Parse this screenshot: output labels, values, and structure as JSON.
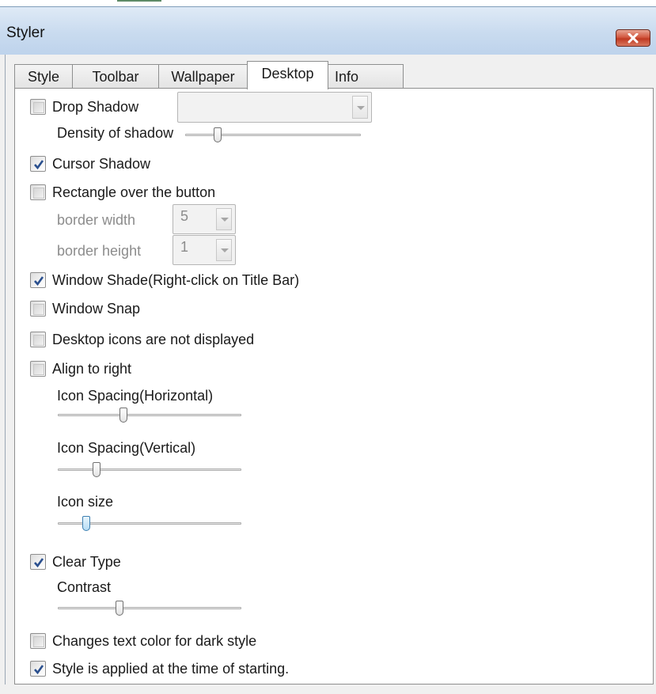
{
  "window": {
    "title": "Styler"
  },
  "tabs": [
    {
      "label": "Style",
      "active": false
    },
    {
      "label": "Toolbar",
      "active": false
    },
    {
      "label": "Wallpaper",
      "active": false
    },
    {
      "label": "Desktop",
      "active": true
    },
    {
      "label": "Info",
      "active": false
    }
  ],
  "desktop": {
    "drop_shadow": {
      "label": "Drop Shadow",
      "checked": false,
      "combo_value": ""
    },
    "density_of_shadow": {
      "label": "Density of shadow",
      "value": 0.17
    },
    "cursor_shadow": {
      "label": "Cursor Shadow",
      "checked": true
    },
    "rectangle_over_button": {
      "label": "Rectangle over the button",
      "checked": false,
      "border_width": {
        "label": "border width",
        "value": "5"
      },
      "border_height": {
        "label": "border height",
        "value": "1"
      }
    },
    "window_shade": {
      "label": "Window Shade(Right-click on Title Bar)",
      "checked": true
    },
    "window_snap": {
      "label": "Window Snap",
      "checked": false
    },
    "desktop_icons_hidden": {
      "label": "Desktop icons are not displayed",
      "checked": false
    },
    "align_to_right": {
      "label": "Align to right",
      "checked": false
    },
    "icon_spacing_horizontal": {
      "label": "Icon Spacing(Horizontal)",
      "value": 0.35
    },
    "icon_spacing_vertical": {
      "label": "Icon Spacing(Vertical)",
      "value": 0.2
    },
    "icon_size": {
      "label": "Icon size",
      "value": 0.14
    },
    "clear_type": {
      "label": "Clear Type",
      "checked": true
    },
    "contrast": {
      "label": "Contrast",
      "value": 0.33
    },
    "dark_style_text": {
      "label": "Changes text color for dark style",
      "checked": false
    },
    "style_at_start": {
      "label": "Style is applied at the time of starting.",
      "checked": true
    }
  },
  "colors": {
    "titlebar": "#c9dbef",
    "close_button": "#c03a22",
    "panel": "#ffffff",
    "window": "#f0f0f0",
    "check_mark": "#2a4f8e"
  },
  "icons": {
    "close": "close-icon",
    "check": "check-icon",
    "dropdown": "chevron-down-icon"
  }
}
